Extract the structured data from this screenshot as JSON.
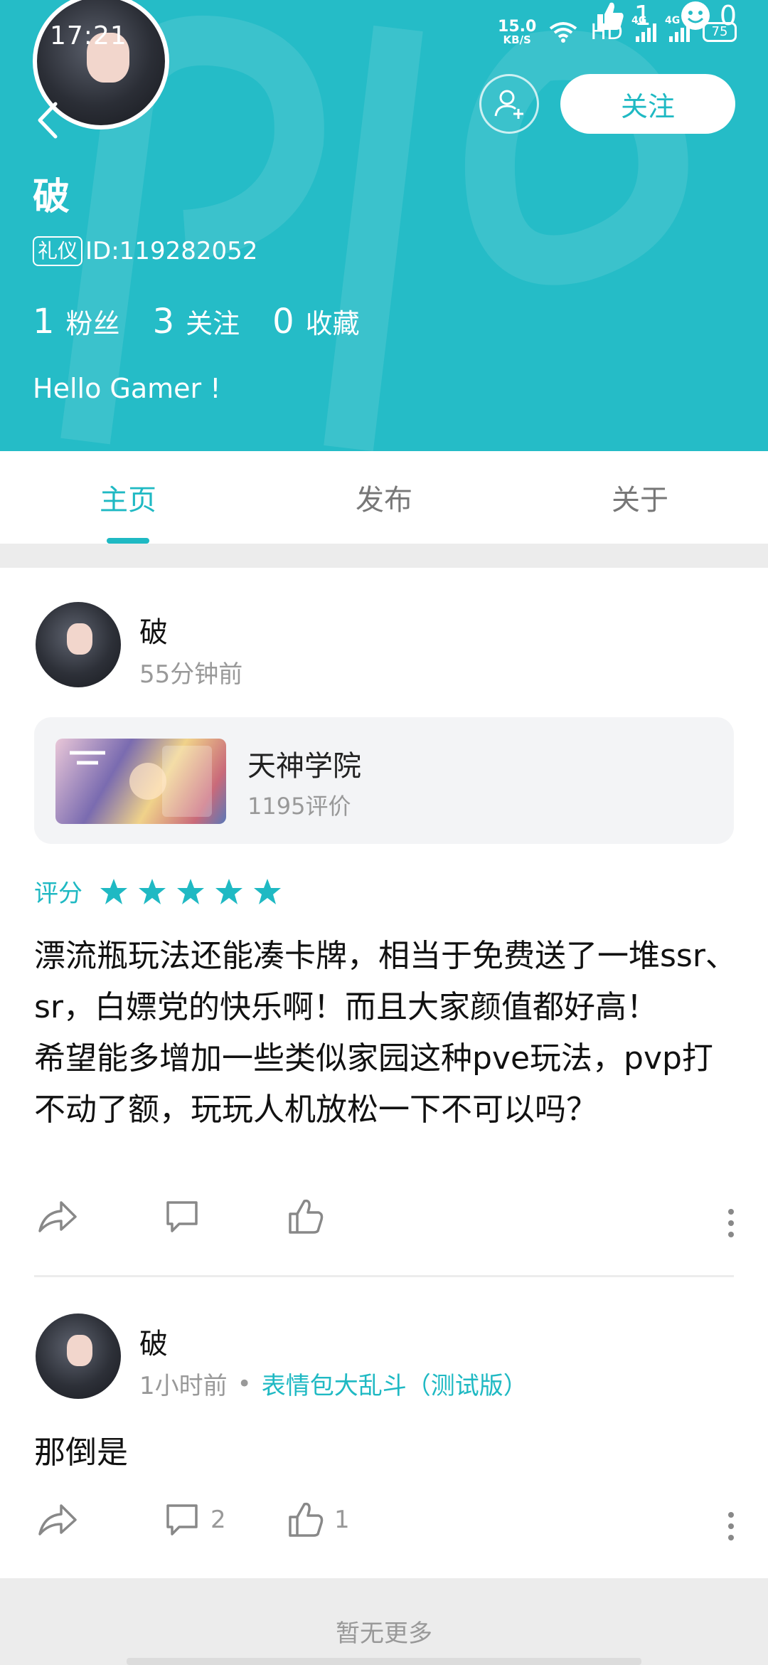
{
  "status_bar": {
    "time": "17:21",
    "net_speed_value": "15.0",
    "net_speed_unit": "KB/S",
    "hd_label": "HD",
    "signal_1_tag": "4G",
    "signal_2_tag": "4G",
    "battery": "75"
  },
  "header": {
    "likes_count": "1",
    "smile_count": "0",
    "follow_button": "关注",
    "username": "破",
    "badge": "礼仪",
    "id_text": "ID:119282052",
    "stats": [
      {
        "num": "1",
        "label": "粉丝"
      },
      {
        "num": "3",
        "label": "关注"
      },
      {
        "num": "0",
        "label": "收藏"
      }
    ],
    "bio": "Hello Gamer !",
    "colors": {
      "accent": "#25bcc7",
      "text_on_accent": "#ffffff"
    }
  },
  "tabs": {
    "items": [
      {
        "label": "主页",
        "active": true
      },
      {
        "label": "发布",
        "active": false
      },
      {
        "label": "关于",
        "active": false
      }
    ]
  },
  "posts": [
    {
      "author": "破",
      "time": "55分钟前",
      "game": {
        "name": "天神学院",
        "reviews": "1195评价"
      },
      "rating_label": "评分",
      "rating_stars": 5,
      "content": "漂流瓶玩法还能凑卡牌，相当于免费送了一堆ssr、sr，白嫖党的快乐啊！而且大家颜值都好高！\n希望能多增加一些类似家园这种pve玩法，pvp打不动了额，玩玩人机放松一下不可以吗？",
      "comments": "",
      "likes": ""
    },
    {
      "author": "破",
      "time": "1小时前",
      "separator": "•",
      "game_link": "表情包大乱斗（测试版）",
      "content": "那倒是",
      "comments": "2",
      "likes": "1"
    }
  ],
  "footer": {
    "text": "暂无更多"
  },
  "icons": [
    "back-arrow-icon",
    "add-friend-icon",
    "thumbs-up-icon",
    "smile-icon",
    "share-icon",
    "comment-icon",
    "like-icon",
    "more-icon",
    "star-icon",
    "wifi-icon",
    "signal-icon",
    "battery-icon"
  ]
}
